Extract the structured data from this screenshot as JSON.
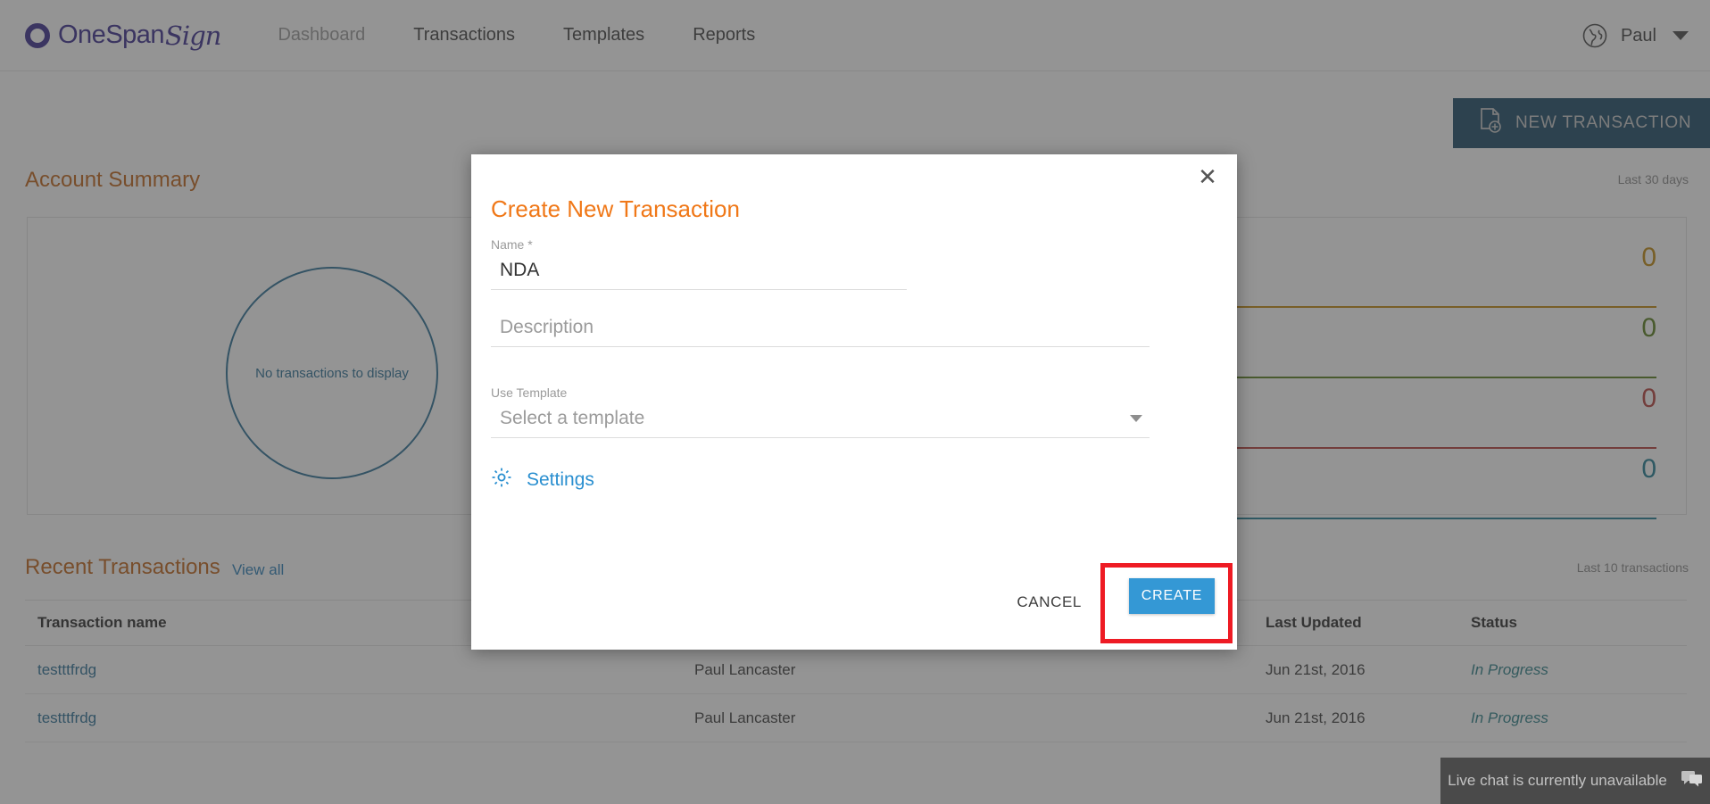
{
  "brand": {
    "name_primary": "OneSpan",
    "name_script": "Sign",
    "logo_color": "#3b2d8f"
  },
  "header": {
    "nav": [
      {
        "label": "Dashboard",
        "active": true
      },
      {
        "label": "Transactions",
        "active": false
      },
      {
        "label": "Templates",
        "active": false
      },
      {
        "label": "Reports",
        "active": false
      }
    ],
    "language_icon": "globe-icon",
    "user": "Paul",
    "user_caret": "chevron-down-icon"
  },
  "actions": {
    "new_transaction": "NEW TRANSACTION",
    "new_transaction_icon": "document-add-icon",
    "new_transaction_bg": "#1b4a66"
  },
  "account_summary": {
    "title": "Account Summary",
    "range": "Last 30 days",
    "donut_empty_text": "No transactions to display",
    "donut_color": "#2a6f96",
    "stats": [
      {
        "label": "",
        "value": "0",
        "color": "#c08a10"
      },
      {
        "label": "",
        "value": "0",
        "color": "#5a7f1e"
      },
      {
        "label": "",
        "value": "0",
        "color": "#b5403c"
      },
      {
        "label": "",
        "value": "0",
        "color": "#1f7d93"
      }
    ]
  },
  "recent_transactions": {
    "title": "Recent Transactions",
    "view_all": "View all",
    "range": "Last 10 transactions",
    "columns": [
      "Transaction name",
      "",
      "Last Updated",
      "Status"
    ],
    "rows": [
      {
        "name": "testttfrdg",
        "owner": "Paul Lancaster",
        "updated": "Jun 21st, 2016",
        "status": "In Progress"
      },
      {
        "name": "testttfrdg",
        "owner": "Paul Lancaster",
        "updated": "Jun 21st, 2016",
        "status": "In Progress"
      }
    ]
  },
  "live_chat": {
    "text": "Live chat is currently unavailable",
    "icon": "chat-bubbles-icon"
  },
  "modal": {
    "title": "Create New Transaction",
    "close_icon": "close-icon",
    "name_label": "Name *",
    "name_value": "NDA",
    "description_placeholder": "Description",
    "description_value": "",
    "template_label": "Use Template",
    "template_placeholder": "Select a template",
    "template_value": "",
    "settings_label": "Settings",
    "settings_icon": "gear-icon",
    "cancel_label": "CANCEL",
    "create_label": "CREATE",
    "create_color": "#3498d5",
    "title_color": "#f07818",
    "highlight_color": "#ee1b24"
  }
}
